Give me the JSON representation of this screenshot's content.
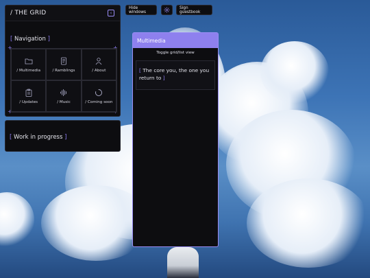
{
  "grid_window": {
    "title": "/ THE GRID",
    "collapse_icon": "chevron-left-icon",
    "nav_heading": "Navigation",
    "items": [
      {
        "label": "/ Multimedia",
        "icon": "folder-icon"
      },
      {
        "label": "/ Ramblings",
        "icon": "book-icon"
      },
      {
        "label": "/ About",
        "icon": "user-icon"
      },
      {
        "label": "/ Updates",
        "icon": "clipboard-icon"
      },
      {
        "label": "/ Music",
        "icon": "waveform-icon"
      },
      {
        "label": "/ Coming soon",
        "icon": "loading-icon"
      }
    ]
  },
  "wip_window": {
    "heading": "Work in progress"
  },
  "toolbar": {
    "hide_label": "Hide windows",
    "settings_icon": "gear-icon",
    "guestbook_label": "Sign guestbook"
  },
  "multimedia_window": {
    "title": "Multimedia",
    "toggle_label": "Toggle grid/list view",
    "track_title": "The core you, the one you return to"
  },
  "colors": {
    "accent": "#8e80ee",
    "bracket": "#8d7cf2",
    "panel": "#0d0d10"
  }
}
